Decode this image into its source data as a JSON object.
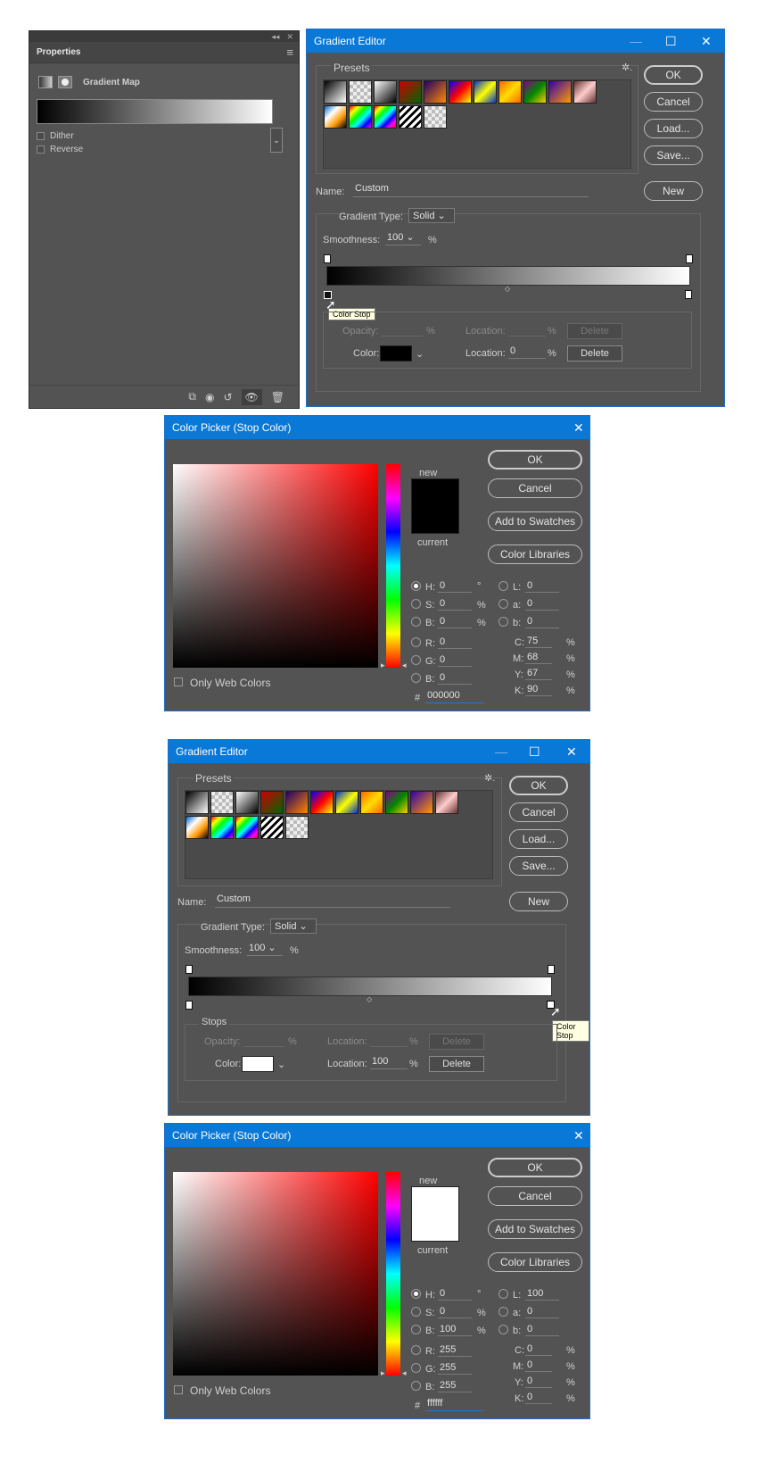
{
  "properties": {
    "tab": "Properties",
    "title": "Gradient Map",
    "dither": "Dither",
    "reverse": "Reverse",
    "topbar_glyphs": [
      "◂◂",
      "✕"
    ],
    "menu_glyph": "≡",
    "dropdown_glyph": "⌄",
    "footer_icons": [
      "⧉",
      "◉",
      "↺",
      "👁",
      "🗑"
    ]
  },
  "gradient_editor_1": {
    "title": "Gradient Editor",
    "title_controls": [
      "—",
      "☐",
      "✕"
    ],
    "presets_label": "Presets",
    "gear_glyph": "✲.",
    "buttons": {
      "ok": "OK",
      "cancel": "Cancel",
      "load": "Load...",
      "save": "Save...",
      "new": "New"
    },
    "name_label": "Name:",
    "name_value": "Custom",
    "gradient_type_label": "Gradient Type:",
    "gradient_type_value": "Solid",
    "smoothness_label": "Smoothness:",
    "smoothness_value": "100",
    "smoothness_unit": "%",
    "opacity_label": "Opacity:",
    "opacity_unit": "%",
    "location_label": "Location:",
    "location_unit": "%",
    "delete_label": "Delete",
    "color_label": "Color:",
    "color_swatch": "#000000",
    "location_value": "0",
    "tooltip": "Color Stop"
  },
  "color_picker_1": {
    "title": "Color Picker (Stop Color)",
    "close": "✕",
    "new_label": "new",
    "current_label": "current",
    "new_color": "#000000",
    "current_color": "#000000",
    "buttons": {
      "ok": "OK",
      "cancel": "Cancel",
      "swatches": "Add to Swatches",
      "libraries": "Color Libraries"
    },
    "fields": {
      "H": "0",
      "S": "0",
      "B": "0",
      "R": "0",
      "G": "0",
      "B2": "0",
      "L": "0",
      "a": "0",
      "b": "0",
      "C": "75",
      "M": "68",
      "Y": "67",
      "K": "90"
    },
    "hex": "000000",
    "only_web": "Only Web Colors"
  },
  "gradient_editor_2": {
    "title": "Gradient Editor",
    "title_controls": [
      "—",
      "☐",
      "✕"
    ],
    "presets_label": "Presets",
    "gear_glyph": "✲.",
    "buttons": {
      "ok": "OK",
      "cancel": "Cancel",
      "load": "Load...",
      "save": "Save...",
      "new": "New"
    },
    "name_label": "Name:",
    "name_value": "Custom",
    "gradient_type_label": "Gradient Type:",
    "gradient_type_value": "Solid",
    "smoothness_label": "Smoothness:",
    "smoothness_value": "100",
    "smoothness_unit": "%",
    "stops_label": "Stops",
    "opacity_label": "Opacity:",
    "opacity_unit": "%",
    "location_label": "Location:",
    "location_unit": "%",
    "delete_label": "Delete",
    "color_label": "Color:",
    "color_swatch": "#ffffff",
    "location_value": "100",
    "tooltip": "Color Stop"
  },
  "color_picker_2": {
    "title": "Color Picker (Stop Color)",
    "close": "✕",
    "new_label": "new",
    "current_label": "current",
    "new_color": "#ffffff",
    "current_color": "#ffffff",
    "buttons": {
      "ok": "OK",
      "cancel": "Cancel",
      "swatches": "Add to Swatches",
      "libraries": "Color Libraries"
    },
    "fields": {
      "H": "0",
      "S": "0",
      "B": "100",
      "R": "255",
      "G": "255",
      "B2": "255",
      "L": "100",
      "a": "0",
      "b": "0",
      "C": "0",
      "M": "0",
      "Y": "0",
      "K": "0"
    },
    "hex": "ffffff",
    "only_web": "Only Web Colors"
  },
  "labels": {
    "H": "H:",
    "S": "S:",
    "B": "B:",
    "R": "R:",
    "G": "G:",
    "L": "L:",
    "a": "a:",
    "b": "b:",
    "C": "C:",
    "M": "M:",
    "Y": "Y:",
    "K": "K:",
    "deg": "°",
    "pct": "%",
    "hash": "#"
  },
  "colors": {
    "titlebar": "#0a78d7",
    "panel": "#535353"
  }
}
